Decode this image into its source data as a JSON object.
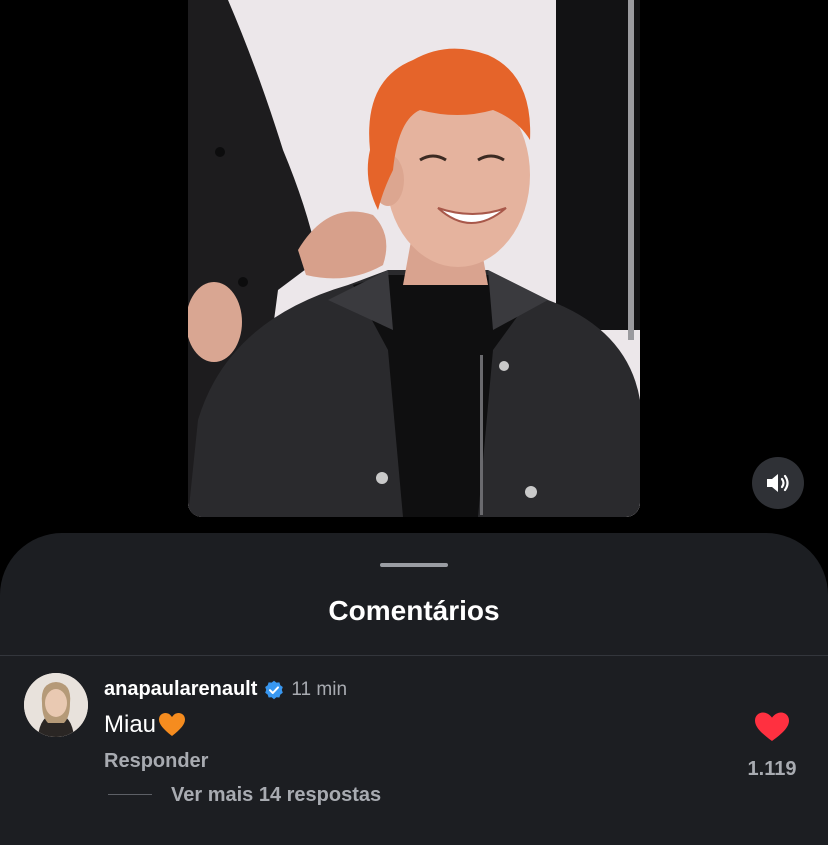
{
  "video": {
    "mute_icon": "volume-icon"
  },
  "sheet": {
    "title": "Comentários"
  },
  "comment": {
    "username": "anapaularenault",
    "verified_icon": "verified-badge-icon",
    "time": "11 min",
    "text": "Miau",
    "emoji": "orange-heart-icon",
    "reply_label": "Responder",
    "more_replies_label": "Ver mais 14 respostas",
    "like_icon": "heart-icon",
    "like_count": "1.119",
    "liked": true
  },
  "colors": {
    "sheet_bg": "#1c1e22",
    "like_red": "#ff3040",
    "verified_blue": "#3897f0",
    "emoji_orange": "#f58c1f",
    "secondary_text": "#a8abb1"
  }
}
